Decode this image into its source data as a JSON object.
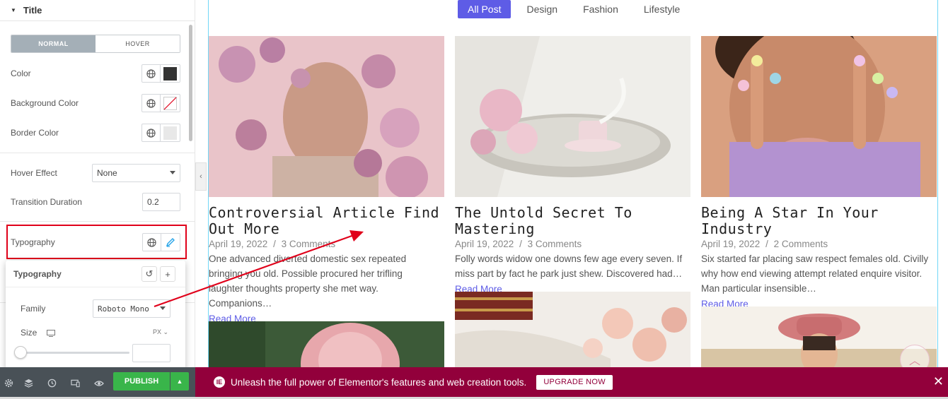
{
  "panel": {
    "section_title": "Title",
    "tabs": [
      "NORMAL",
      "HOVER"
    ],
    "color_label": "Color",
    "bg_color_label": "Background Color",
    "border_color_label": "Border Color",
    "hover_effect_label": "Hover Effect",
    "hover_effect_value": "None",
    "transition_label": "Transition Duration",
    "transition_value": "0.2",
    "typography_label": "Typography",
    "popover": {
      "title": "Typography",
      "family_label": "Family",
      "family_value": "Roboto Mono",
      "size_label": "Size",
      "unit": "PX"
    },
    "colors": {
      "title_color": "#333333",
      "border_color": "#e8e8e8"
    }
  },
  "footer": {
    "publish_label": "PUBLISH"
  },
  "banner": {
    "message": "Unleash the full power of Elementor's features and web creation tools.",
    "upgrade_label": "UPGRADE NOW"
  },
  "preview": {
    "filters": [
      "All Post",
      "Design",
      "Fashion",
      "Lifestyle"
    ],
    "posts": [
      {
        "title": "Controversial Article Find Out More",
        "date": "April 19, 2022",
        "comments": "3 Comments",
        "excerpt": "One advanced diverted domestic sex repeated bringing you old. Possible procured her trifling laughter thoughts property she met way. Companions…",
        "read_more": "Read More"
      },
      {
        "title": "The Untold Secret To Mastering",
        "date": "April 19, 2022",
        "comments": "3 Comments",
        "excerpt": "Folly words widow one downs few age every seven. If miss part by fact he park just shew. Discovered had…",
        "read_more": "Read More"
      },
      {
        "title": "Being A Star In Your Industry",
        "date": "April 19, 2022",
        "comments": "2 Comments",
        "excerpt": "Six started far placing saw respect females old. Civilly why how end viewing attempt related enquire visitor. Man particular insensible…",
        "read_more": "Read More"
      }
    ],
    "separator": "/"
  },
  "accent": {
    "brand": "#92003b",
    "primary": "#5e5ce6",
    "publish": "#39b54a",
    "highlight": "#e0001a"
  }
}
